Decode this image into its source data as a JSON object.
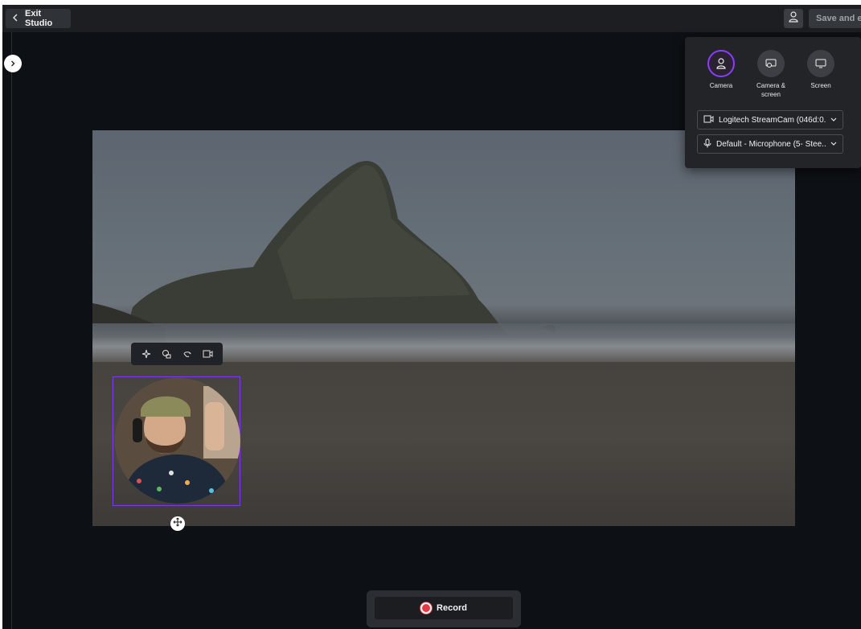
{
  "topbar": {
    "exit_label": "Exit Studio",
    "save_label": "Save and exit"
  },
  "panel": {
    "modes": [
      {
        "label": "Camera",
        "icon": "person-icon",
        "active": true
      },
      {
        "label": "Camera & screen",
        "icon": "camera-screen-icon",
        "active": false
      },
      {
        "label": "Screen",
        "icon": "screen-icon",
        "active": false
      }
    ],
    "camera_select": "Logitech StreamCam (046d:0...",
    "mic_select": "Default - Microphone (5- Stee..."
  },
  "record": {
    "label": "Record"
  },
  "colors": {
    "accent": "#8b3dff",
    "record_red": "#e53946",
    "frame": "#7c3aed"
  }
}
